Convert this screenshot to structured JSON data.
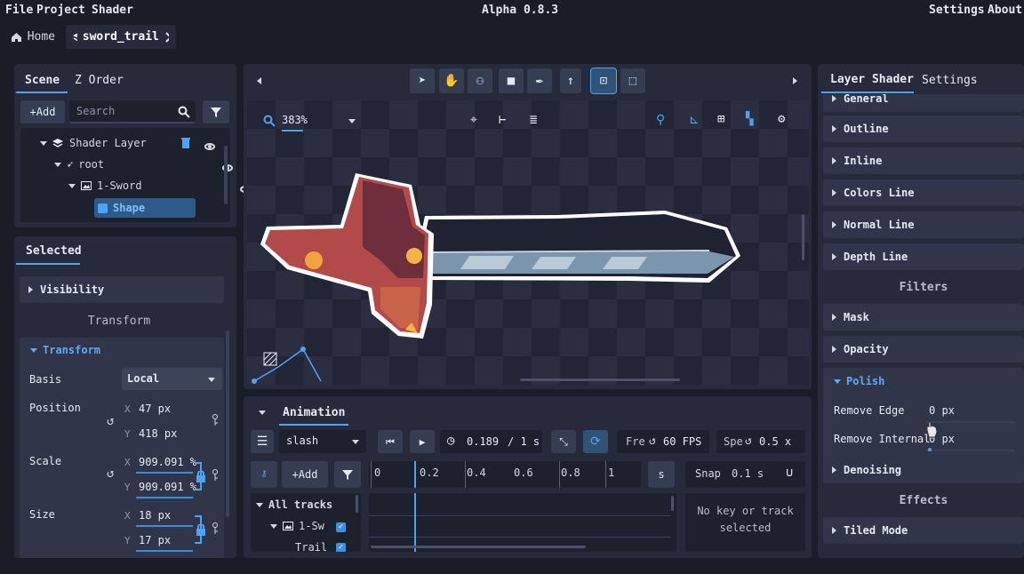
{
  "menu": {
    "file": "File",
    "project": "Project",
    "shader": "Shader",
    "title": "Alpha 0.8.3",
    "settings": "Settings",
    "about": "About"
  },
  "tabs": {
    "home": "Home",
    "doc": "sword_trail"
  },
  "scene": {
    "tab_scene": "Scene",
    "tab_zorder": "Z Order",
    "add": "+Add",
    "search_placeholder": "Search",
    "tree": [
      {
        "label": "Shader Layer"
      },
      {
        "label": "root"
      },
      {
        "label": "1-Sword"
      },
      {
        "label": "Shape"
      }
    ]
  },
  "selected": {
    "title": "Selected",
    "visibility": "Visibility",
    "transform_header": "Transform",
    "transform_section": "Transform",
    "basis_label": "Basis",
    "basis_value": "Local",
    "position_label": "Position",
    "pos_x": "47 px",
    "pos_y": "418 px",
    "scale_label": "Scale",
    "scale_x": "909.091 %",
    "scale_y": "909.091 %",
    "size_label": "Size",
    "size_x": "18 px",
    "size_y": "17 px",
    "x": "X",
    "y": "Y"
  },
  "viewport": {
    "zoom": "383%"
  },
  "animation": {
    "tab": "Animation",
    "clip": "slash",
    "time": "0.189",
    "duration": "/ 1 s",
    "fps_label": "Fre",
    "fps": "60 FPS",
    "speed_label": "Spe",
    "speed": "0.5 x",
    "add": "+Add",
    "unit": "s",
    "snap_label": "Snap",
    "snap_value": "0.1 s",
    "ruler": [
      "0",
      "0.2",
      "0.4",
      "0.6",
      "0.8",
      "1"
    ],
    "all_tracks": "All tracks",
    "track1": "1-Sw",
    "track2": "Trail",
    "empty_line1": "No key or track",
    "empty_line2": "selected"
  },
  "layer_shader": {
    "tab_shader": "Layer Shader",
    "tab_settings": "Settings",
    "general": "General",
    "outline": "Outline",
    "inline": "Inline",
    "colors_line": "Colors Line",
    "normal_line": "Normal Line",
    "depth_line": "Depth Line",
    "filters": "Filters",
    "mask": "Mask",
    "opacity": "Opacity",
    "polish": "Polish",
    "remove_edge_label": "Remove Edge",
    "remove_edge_value": "0 px",
    "remove_internal_label": "Remove Internal",
    "remove_internal_value": "0 px",
    "denoising": "Denoising",
    "effects": "Effects",
    "tiled_mode": "Tiled Mode"
  },
  "colors": {
    "accent": "#4da3f7",
    "bg": "#1a1c27",
    "panel": "#262a3b"
  }
}
